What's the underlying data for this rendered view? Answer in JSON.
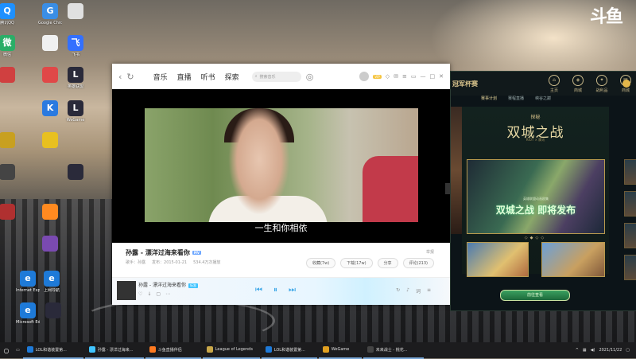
{
  "desktop": {
    "icons": [
      {
        "label": "腾讯QQ",
        "glyph": "Q",
        "color": "#1e90ff"
      },
      {
        "label": "Google Chrome",
        "glyph": "G",
        "color": "#3a8ee6"
      },
      {
        "label": "",
        "glyph": "",
        "color": "#e0e0e0"
      },
      {
        "label": "微信",
        "glyph": "微",
        "color": "#2aae67"
      },
      {
        "label": "",
        "glyph": "",
        "color": "#f0f0f0"
      },
      {
        "label": "飞书",
        "glyph": "飞",
        "color": "#3370ff"
      },
      {
        "label": "",
        "glyph": "",
        "color": "#d04040"
      },
      {
        "label": "",
        "glyph": "",
        "color": "#e04848"
      },
      {
        "label": "英雄联盟",
        "glyph": "L",
        "color": "#2a2a3a"
      },
      {
        "label": "",
        "glyph": "K",
        "color": "#2a7ae0"
      },
      {
        "label": "WeGame",
        "glyph": "L",
        "color": "#2a2a3a"
      },
      {
        "label": "",
        "glyph": "",
        "color": "#c8a020"
      },
      {
        "label": "",
        "glyph": "",
        "color": "#e8c020"
      },
      {
        "label": "",
        "glyph": "",
        "color": "#444"
      },
      {
        "label": "",
        "glyph": "",
        "color": "#2a2a3a"
      },
      {
        "label": "",
        "glyph": "",
        "color": "#b03030"
      },
      {
        "label": "",
        "glyph": "",
        "color": "#ff8a20"
      },
      {
        "label": "",
        "glyph": "",
        "color": "#7a4ab0"
      },
      {
        "label": "Internet Explorer",
        "glyph": "e",
        "color": "#1e7ad8"
      },
      {
        "label": "上网导航",
        "glyph": "e",
        "color": "#1e7ad8"
      },
      {
        "label": "Microsoft Edge",
        "glyph": "e",
        "color": "#1e7ad8"
      },
      {
        "label": "",
        "glyph": "",
        "color": "#2a2a3a"
      }
    ]
  },
  "douyu": {
    "mark": "斗鱼",
    "sub": ""
  },
  "player": {
    "tabs": [
      "音乐",
      "直播",
      "听书",
      "探索"
    ],
    "search_placeholder": "搜索音乐",
    "subtitle": "一生和你相依",
    "song_title": "孙露 - 漂洋过海来看你",
    "mv_badge": "MV",
    "report": "举报",
    "meta": {
      "artist": "歌手：孙露",
      "date": "发布：2015-01-21",
      "plays": "534.4万次播放"
    },
    "actions": [
      "收藏(7w)",
      "下载(17w)",
      "分享",
      "评论(213)"
    ],
    "now_playing": {
      "title": "孙露 - 漂洋过海来看你",
      "tag": "标准"
    }
  },
  "game": {
    "header": "冠军杯赛",
    "nav": [
      "主页",
      "商城",
      "战利品",
      "商城"
    ],
    "subnav": [
      "赛事计划",
      "赛程直播",
      "峡谷之巅"
    ],
    "subnav_active": 0,
    "title_small": "探秘",
    "title": "双城之战",
    "title_en": "RIOT × 腾讯",
    "banner_cap": "英雄联盟动画剧集",
    "banner_text": "双城之战 即将发布",
    "card1": "",
    "card2": "",
    "button": "前往查看"
  },
  "taskbar": {
    "items": [
      {
        "label": "LOL和谐装置第...",
        "color": "#1e7ad8"
      },
      {
        "label": "孙露 - 漂洋过海来...",
        "color": "#40c4ff"
      },
      {
        "label": "斗鱼直播伴侣",
        "color": "#ff7a20"
      },
      {
        "label": "League of Legends",
        "color": "#c9a84a"
      },
      {
        "label": "LOL和谐装置第...",
        "color": "#1e7ad8"
      },
      {
        "label": "WeGame",
        "color": "#e0a020"
      },
      {
        "label": "未来战士 - 桃花...",
        "color": "#444"
      }
    ],
    "time": "",
    "date": "2021/11/22"
  }
}
